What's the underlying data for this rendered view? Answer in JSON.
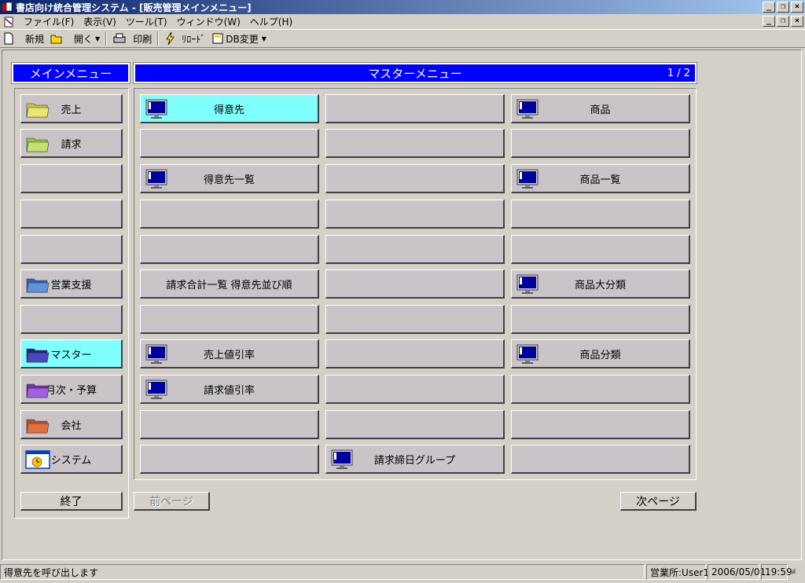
{
  "window": {
    "title": "書店向け統合管理システム - [販売管理メインメニュー]",
    "min": "_",
    "max": "❐",
    "close": "×"
  },
  "menu": [
    "ファイル(F)",
    "表示(V)",
    "ツール(T)",
    "ウィンドウ(W)",
    "ヘルプ(H)"
  ],
  "toolbar": {
    "new": "新規",
    "open": "開く",
    "print": "印刷",
    "reload": "ﾘﾛｰﾄﾞ",
    "db": "DB変更"
  },
  "main_menu": {
    "title": "メインメニュー",
    "items": [
      "売上",
      "請求",
      "",
      "",
      "",
      "営業支援",
      "",
      "マスター",
      "月次・予算",
      "会社",
      "システム"
    ],
    "icons": [
      "folder-yellow-icon",
      "folder-green-icon",
      "",
      "",
      "",
      "folder-blue-icon",
      "",
      "folder-navy-icon",
      "folder-purple-icon",
      "folder-orange-icon",
      "system-clock-icon"
    ],
    "active_index": 7,
    "exit": "終了"
  },
  "master_menu": {
    "title": "マスターメニュー",
    "page": "1 / 2",
    "columns": [
      [
        "得意先",
        "",
        "得意先一覧",
        "",
        "",
        "請求合計一覧 得意先並び順",
        "",
        "売上値引率",
        "請求値引率",
        "",
        ""
      ],
      [
        "",
        "",
        "",
        "",
        "",
        "",
        "",
        "",
        "",
        "",
        "請求締日グループ"
      ],
      [
        "商品",
        "",
        "商品一覧",
        "",
        "",
        "商品大分類",
        "",
        "商品分類",
        "",
        "",
        ""
      ]
    ],
    "icons": [
      [
        true,
        false,
        true,
        false,
        false,
        false,
        false,
        true,
        true,
        false,
        false
      ],
      [
        false,
        false,
        false,
        false,
        false,
        false,
        false,
        false,
        false,
        false,
        true
      ],
      [
        true,
        false,
        true,
        false,
        false,
        true,
        false,
        true,
        false,
        false,
        false
      ]
    ],
    "active": [
      0,
      0
    ],
    "prev": "前ページ",
    "next": "次ページ"
  },
  "status": {
    "message": "得意先を呼び出します",
    "office": "営業所:User1",
    "date": "2006/05/01",
    "time": "19:59"
  },
  "colors": {
    "header_blue": "#0000ff",
    "active_cyan": "#80ffff",
    "button_gray": "#c8c4c8"
  }
}
